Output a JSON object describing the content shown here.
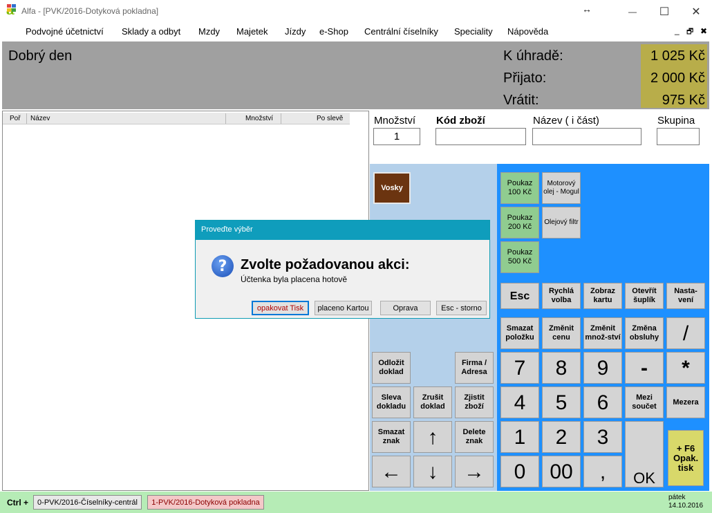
{
  "window": {
    "logo_glyph": "α",
    "title": "Alfa - [PVK/2016-Dotyková pokladna]",
    "resize_glyph": "↔",
    "minimize_glyph": "—",
    "maximize_glyph": "☐",
    "close_glyph": "✕"
  },
  "menu": {
    "items": [
      "Podvojné účetnictví",
      "Sklady a odbyt",
      "Mzdy",
      "Majetek",
      "Jízdy",
      "e-Shop",
      "Centrální číselníky",
      "Speciality",
      "Nápověda"
    ],
    "mdi_minimize": "_",
    "mdi_restore": "🗗",
    "mdi_close": "✖"
  },
  "header": {
    "greeting": "Dobrý den",
    "labels": [
      "K úhradě:",
      "Přijato:",
      "Vrátit:"
    ],
    "values": [
      "1 025 Kč",
      "2 000 Kč",
      "975 Kč"
    ]
  },
  "grid": {
    "columns": [
      "Poř",
      "Název",
      "Množství",
      "Po slevě"
    ]
  },
  "fields": {
    "quantity_label": "Množství",
    "quantity_value": "1",
    "code_label": "Kód zboží",
    "name_label": "Název ( i část)",
    "group_label": "Skupina"
  },
  "left_pad": {
    "vosky": "Vosky",
    "odlozit": "Odložit doklad",
    "firma": "Firma / Adresa",
    "sleva": "Sleva dokladu",
    "zrusit": "Zrušit doklad",
    "zjistit": "Zjistit zboží",
    "smazat_znak": "Smazat znak",
    "up": "↑",
    "delete_znak": "Delete znak",
    "left": "←",
    "down": "↓",
    "right": "→"
  },
  "right_pad": {
    "poukaz100": "Poukaz 100 Kč",
    "motorovy": "Motorový olej - Mogul",
    "poukaz200": "Poukaz 200 Kč",
    "olejovy": "Olejový filtr",
    "poukaz500": "Poukaz 500 Kč",
    "esc": "Esc",
    "rychla": "Rychlá volba",
    "zobraz": "Zobraz kartu",
    "otevrit": "Otevřít šuplík",
    "nastaveni": "Nasta-vení",
    "smazat_polozku": "Smazat položku",
    "zmenit_cenu": "Změnit cenu",
    "zmenit_mnozstvi": "Změnit množ-ství",
    "zmena_obsluhy": "Změna obsluhy",
    "divide": "/",
    "n7": "7",
    "n8": "8",
    "n9": "9",
    "minus": "-",
    "mult": "*",
    "n4": "4",
    "n5": "5",
    "n6": "6",
    "mezi": "Mezi součet",
    "mezera": "Mezera",
    "n1": "1",
    "n2": "2",
    "n3": "3",
    "ok": "OK",
    "f6": "+ F6 Opak. tisk",
    "n0": "0",
    "n00": "00",
    "comma": ","
  },
  "dialog": {
    "title": "Proveďte výběr",
    "heading": "Zvolte požadovanou akci:",
    "message": "Účtenka byla placena hotově",
    "buttons": [
      "opakovat Tisk",
      "placeno Kartou",
      "Oprava",
      "Esc - storno"
    ]
  },
  "status": {
    "ctrl": "Ctrl +",
    "tabs": [
      "0-PVK/2016-Číselníky-centrál",
      "1-PVK/2016-Dotyková pokladna"
    ],
    "day": "pátek",
    "date": "14.10.2016"
  },
  "colors": {
    "header_bg": "#a0a0a0",
    "totals_bg": "#b8ad4a",
    "left_pad_bg": "#b4d0ea",
    "right_pad_bg": "#1e90ff",
    "status_bg": "#b6ecb6",
    "dialog_accent": "#0f9dbc"
  }
}
